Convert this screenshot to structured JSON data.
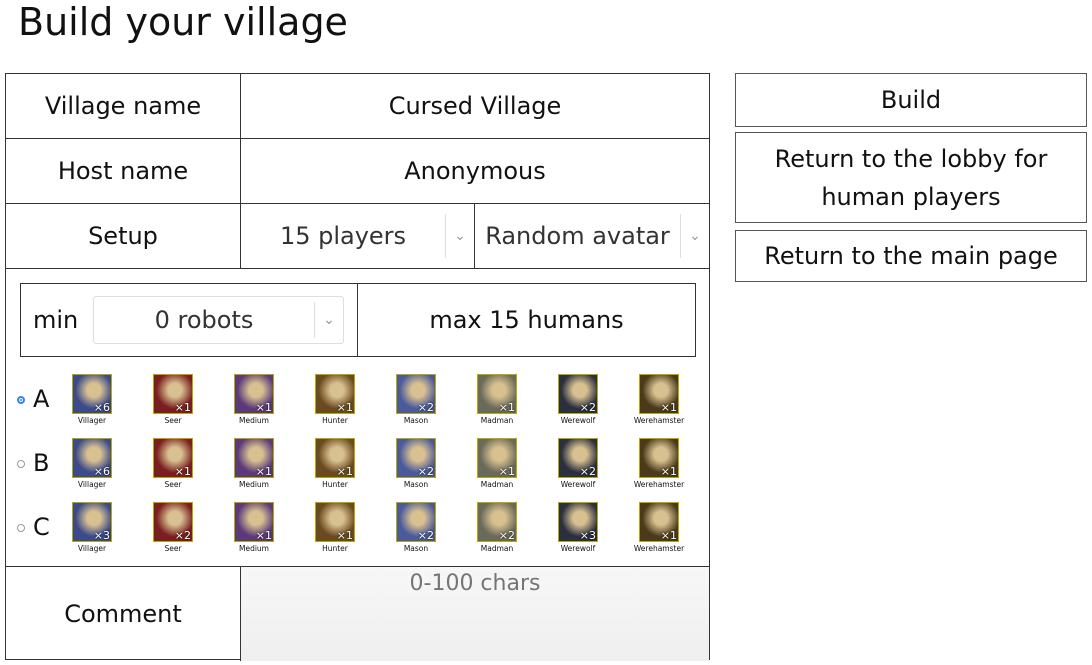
{
  "page": {
    "title": "Build your village"
  },
  "form": {
    "village_name": {
      "label": "Village name",
      "value": "Cursed Village"
    },
    "host_name": {
      "label": "Host name",
      "value": "Anonymous"
    },
    "setup": {
      "label": "Setup",
      "players": "15 players",
      "avatar": "Random avatar"
    },
    "limits": {
      "min_label": "min",
      "robots": "0 robots",
      "max_text": "max 15 humans"
    },
    "comment": {
      "label": "Comment",
      "placeholder": "0-100 chars"
    }
  },
  "roles": [
    {
      "name": "Villager",
      "icon": "villager-icon",
      "color": "#3a4a8a"
    },
    {
      "name": "Seer",
      "icon": "seer-icon",
      "color": "#7a1f1f"
    },
    {
      "name": "Medium",
      "icon": "medium-icon",
      "color": "#5a3a7a"
    },
    {
      "name": "Hunter",
      "icon": "hunter-icon",
      "color": "#6a4a20"
    },
    {
      "name": "Mason",
      "icon": "mason-icon",
      "color": "#4a5a9a"
    },
    {
      "name": "Madman",
      "icon": "madman-icon",
      "color": "#6a6a5a"
    },
    {
      "name": "Werewolf",
      "icon": "werewolf-icon",
      "color": "#2a3040"
    },
    {
      "name": "Werehamster",
      "icon": "werehamster-icon",
      "color": "#4a3a1a"
    }
  ],
  "setups": [
    {
      "letter": "A",
      "selected": true,
      "counts": [
        "×6",
        "×1",
        "×1",
        "×1",
        "×2",
        "×1",
        "×2",
        "×1"
      ]
    },
    {
      "letter": "B",
      "selected": false,
      "counts": [
        "×6",
        "×1",
        "×1",
        "×1",
        "×2",
        "×1",
        "×2",
        "×1"
      ]
    },
    {
      "letter": "C",
      "selected": false,
      "counts": [
        "×3",
        "×2",
        "×1",
        "×1",
        "×2",
        "×2",
        "×3",
        "×1"
      ]
    }
  ],
  "buttons": {
    "build": "Build",
    "lobby": "Return to the lobby for human players",
    "main": "Return to the main page"
  }
}
